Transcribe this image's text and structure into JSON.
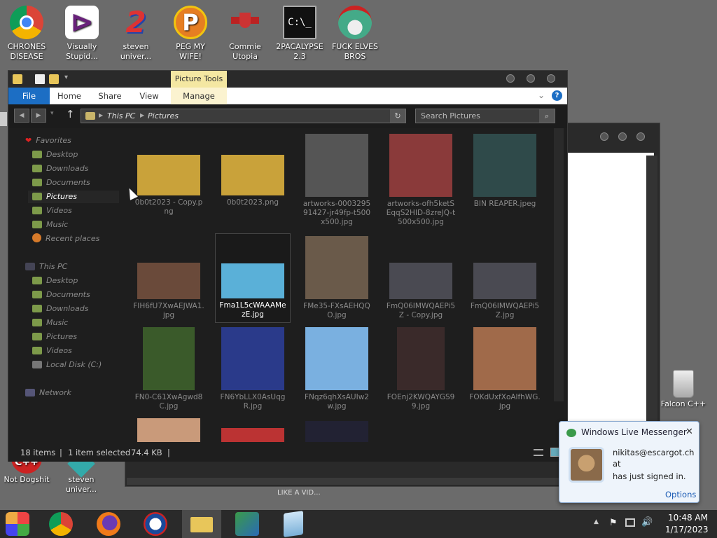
{
  "desktop": {
    "icons": [
      {
        "label": "CHRONES DISEASE",
        "color": "#e74c3c"
      },
      {
        "label": "Visually Stupid...",
        "color": "#8e44ad"
      },
      {
        "label": "steven univer...",
        "color": "#c0392b"
      },
      {
        "label": "PEG MY WIFE!",
        "color": "#e67e22"
      },
      {
        "label": "Commie Utopia",
        "color": "#a33"
      },
      {
        "label": "2PACALYPSE 2.3",
        "color": "#111"
      },
      {
        "label": "FUCK ELVES BROS",
        "color": "#4a8"
      }
    ],
    "bottom_icons": [
      {
        "label": "Not Dogshit"
      },
      {
        "label": "steven univer..."
      }
    ],
    "recycle_label": "Falcon C++",
    "partial_text": "LIKE A VID..."
  },
  "explorer": {
    "picture_tools": "Picture Tools",
    "tabs": [
      "File",
      "Home",
      "Share",
      "View",
      "Manage"
    ],
    "breadcrumb": [
      "This PC",
      "Pictures"
    ],
    "search_placeholder": "Search Pictures",
    "sidebar": {
      "favorites_label": "Favorites",
      "favorites": [
        "Desktop",
        "Downloads",
        "Documents",
        "Pictures",
        "Videos",
        "Music",
        "Recent places"
      ],
      "thispc_label": "This PC",
      "thispc": [
        "Desktop",
        "Documents",
        "Downloads",
        "Music",
        "Pictures",
        "Videos",
        "Local Disk (C:)"
      ],
      "network_label": "Network"
    },
    "files": [
      {
        "name": "0b0t2023 - Copy.png",
        "color": "#c9a23a"
      },
      {
        "name": "0b0t2023.png",
        "color": "#c9a23a"
      },
      {
        "name": "artworks-000329591427-jr49fp-t500x500.jpg",
        "color": "#555"
      },
      {
        "name": "artworks-ofh5ketSEqqS2HID-8zreJQ-t500x500.jpg",
        "color": "#8a3a3a"
      },
      {
        "name": "BIN REAPER.jpeg",
        "color": "#2f4a4a"
      },
      {
        "name": "FIH6fU7XwAEJWA1.jpg",
        "color": "#6a4a3a"
      },
      {
        "name": "Fma1L5cWAAAMezE.jpg",
        "color": "#5ab0d8"
      },
      {
        "name": "FMe35-FXsAEHQQO.jpg",
        "color": "#6a5a4a"
      },
      {
        "name": "FmQ06IMWQAEPi5Z - Copy.jpg",
        "color": "#4a4a52"
      },
      {
        "name": "FmQ06IMWQAEPi5Z.jpg",
        "color": "#4a4a52"
      },
      {
        "name": "FN0-C61XwAgwd8C.jpg",
        "color": "#3a5a2a"
      },
      {
        "name": "FN6YbLLX0AsUqgR.jpg",
        "color": "#2a3a8a"
      },
      {
        "name": "FNqz6qhXsAUIw2w.jpg",
        "color": "#7ab0e0"
      },
      {
        "name": "FOEnj2KWQAYGS99.jpg",
        "color": "#3a2a2a"
      },
      {
        "name": "FOKdUxfXoAlfhWG.jpg",
        "color": "#a06a4a"
      }
    ],
    "status": {
      "count": "18 items",
      "selected": "1 item selected",
      "size": "74.4 KB"
    }
  },
  "toast": {
    "title": "Windows Live Messenger",
    "email": "nikitas@escargot.chat",
    "message": "has just signed in.",
    "options": "Options"
  },
  "taskbar": {
    "time": "10:48 AM",
    "date": "1/17/2023"
  }
}
